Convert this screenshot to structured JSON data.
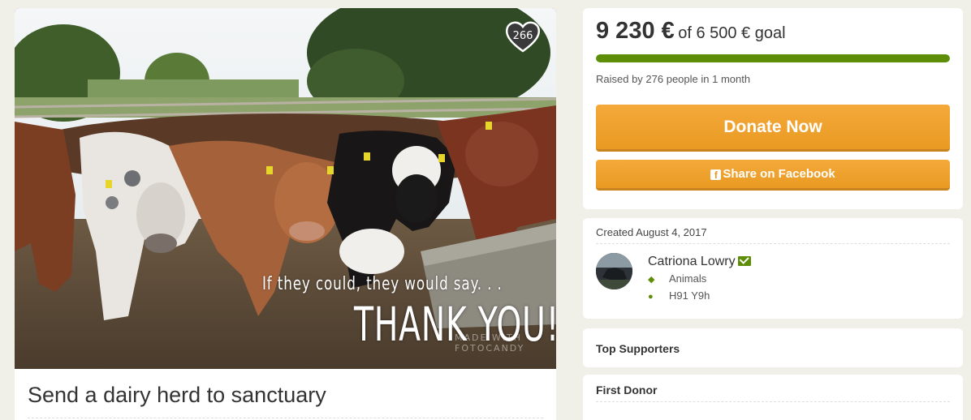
{
  "campaign": {
    "title": "Send a dairy herd to sanctuary",
    "heart_count": "266",
    "photo_overlay_line1": "If they could, they would say. . .",
    "photo_overlay_line2": "THANK YOU!",
    "photo_watermark_line1": "MADE WITH",
    "photo_watermark_line2": "FOTOCANDY"
  },
  "funding": {
    "amount": "9 230 €",
    "goal_text": "of 6 500 € goal",
    "progress": 1.0,
    "raised_by": "Raised by 276 people in 1 month",
    "donate_label": "Donate Now",
    "share_label": "Share on Facebook"
  },
  "organizer": {
    "created": "Created August 4, 2017",
    "name": "Catriona Lowry",
    "category": "Animals",
    "location": "H91 Y9h"
  },
  "sections": {
    "top_supporters": "Top Supporters",
    "first_donor": "First Donor"
  },
  "colors": {
    "accent_green": "#5e8d07",
    "donate_orange": "#f0a32e",
    "page_bg": "#f0efe8"
  },
  "icons": [
    "heart-icon",
    "facebook-icon",
    "envelope-icon",
    "tag-icon",
    "map-marker-icon"
  ]
}
